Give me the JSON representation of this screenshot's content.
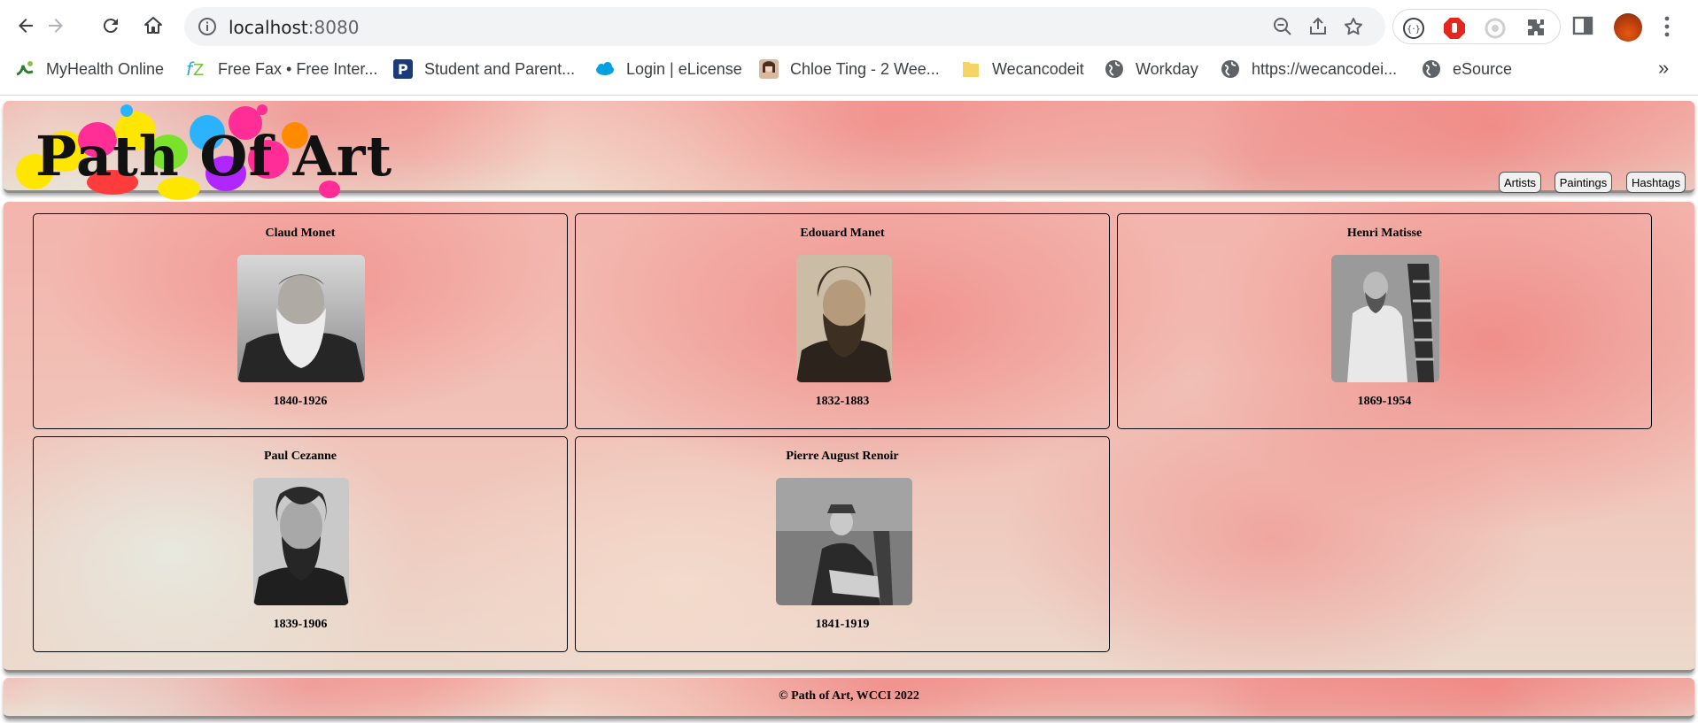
{
  "browser": {
    "url_host": "localhost",
    "url_port": ":8080",
    "bookmarks": [
      {
        "label": "MyHealth Online",
        "icon": "myhealth-icon"
      },
      {
        "label": "Free Fax • Free Inter...",
        "icon": "fz-icon"
      },
      {
        "label": "Student and Parent...",
        "icon": "powerschool-icon"
      },
      {
        "label": "Login | eLicense",
        "icon": "salesforce-cloud-icon"
      },
      {
        "label": "Chloe Ting - 2 Wee...",
        "icon": "person-thumbnail-icon"
      },
      {
        "label": "Wecancodeit",
        "icon": "folder-icon"
      },
      {
        "label": "Workday",
        "icon": "globe-icon"
      },
      {
        "label": "https://wecancodei...",
        "icon": "globe-icon"
      },
      {
        "label": "eSource",
        "icon": "globe-icon"
      }
    ],
    "more_bookmarks": "»"
  },
  "site": {
    "logo_text": "Path Of Art",
    "nav": [
      {
        "label": "Artists"
      },
      {
        "label": "Paintings"
      },
      {
        "label": "Hashtags"
      }
    ],
    "artists": [
      {
        "name": "Claud Monet",
        "years": "1840-1926"
      },
      {
        "name": "Edouard Manet",
        "years": "1832-1883"
      },
      {
        "name": "Henri Matisse",
        "years": "1869-1954"
      },
      {
        "name": "Paul Cezanne",
        "years": "1839-1906"
      },
      {
        "name": "Pierre August Renoir",
        "years": "1841-1919"
      }
    ],
    "footer": "© Path of Art, WCCI 2022"
  },
  "colors": {
    "paper_pink": "#f3b4ac",
    "logo_splashes": [
      "#ffe600",
      "#ff2d95",
      "#2bb3ff",
      "#7ae12c",
      "#ff8a00",
      "#b026ff",
      "#ff3b3b"
    ]
  }
}
